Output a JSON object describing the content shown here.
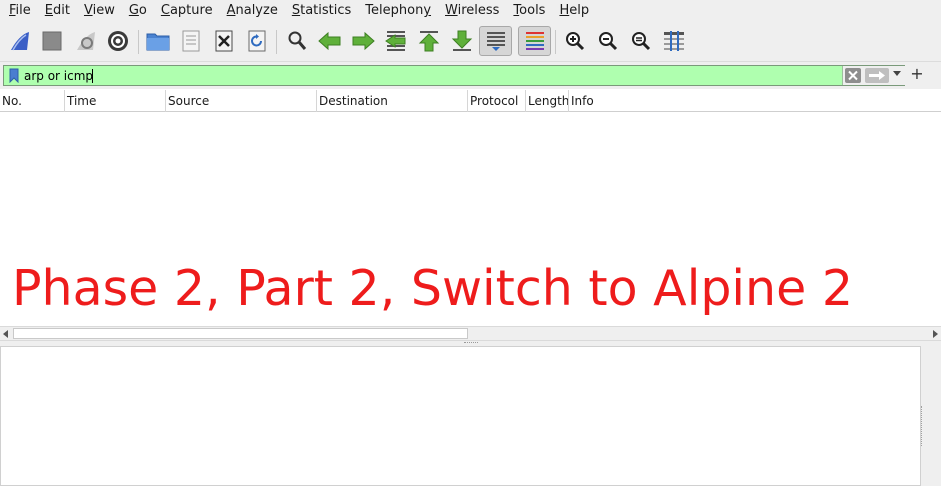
{
  "menubar": {
    "items": [
      {
        "label_pre": "",
        "mnemonic": "F",
        "label_post": "ile"
      },
      {
        "label_pre": "",
        "mnemonic": "E",
        "label_post": "dit"
      },
      {
        "label_pre": "",
        "mnemonic": "V",
        "label_post": "iew"
      },
      {
        "label_pre": "",
        "mnemonic": "G",
        "label_post": "o"
      },
      {
        "label_pre": "",
        "mnemonic": "C",
        "label_post": "apture"
      },
      {
        "label_pre": "",
        "mnemonic": "A",
        "label_post": "nalyze"
      },
      {
        "label_pre": "",
        "mnemonic": "S",
        "label_post": "tatistics"
      },
      {
        "label_pre": "Telephon",
        "mnemonic": "y",
        "label_post": ""
      },
      {
        "label_pre": "",
        "mnemonic": "W",
        "label_post": "ireless"
      },
      {
        "label_pre": "",
        "mnemonic": "T",
        "label_post": "ools"
      },
      {
        "label_pre": "",
        "mnemonic": "H",
        "label_post": "elp"
      }
    ]
  },
  "toolbar": {
    "icons": [
      "shark-fin-start-icon",
      "stop-icon",
      "restart-icon",
      "capture-options-gear-icon",
      "open-folder-icon",
      "save-file-icon",
      "close-file-icon",
      "reload-icon",
      "find-packet-icon",
      "go-back-icon",
      "go-forward-icon",
      "go-to-packet-icon",
      "first-packet-icon",
      "last-packet-icon",
      "autoscroll-icon",
      "colorize-icon",
      "zoom-in-icon",
      "zoom-out-icon",
      "zoom-normal-icon",
      "resize-columns-icon"
    ]
  },
  "filter": {
    "value": "arp or icmp",
    "background": "#afffaf"
  },
  "columns": {
    "no": "No.",
    "time": "Time",
    "source": "Source",
    "destination": "Destination",
    "protocol": "Protocol",
    "length": "Length",
    "info": "Info"
  },
  "overlay": {
    "caption": "Phase 2, Part 2, Switch to Alpine 2",
    "color": "#ee1c1c"
  }
}
